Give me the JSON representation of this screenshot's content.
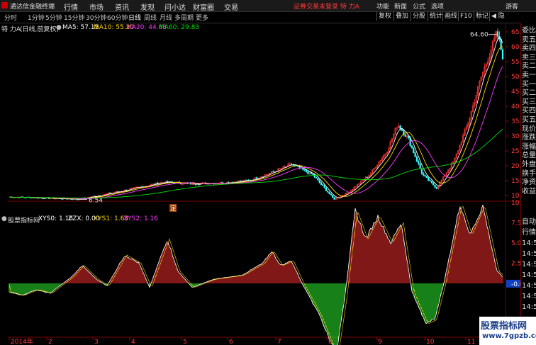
{
  "app": {
    "title": "通达信金融终端",
    "guest_label": "游客"
  },
  "menu": [
    "行情",
    "市场",
    "资讯",
    "发现",
    "问小达",
    "财富圈",
    "交易"
  ],
  "menu_right": {
    "warn": "证券交易未登录  特 力A",
    "items": [
      "功能",
      "新面",
      "公式",
      "选项"
    ]
  },
  "periods": [
    "分时",
    "1分钟",
    "5分钟",
    "15分钟",
    "30分钟",
    "60分钟",
    "日线",
    "周线",
    "月线",
    "多周期",
    "更多"
  ],
  "selected_period": "日线",
  "tools": [
    "复权",
    "叠加",
    "分股",
    "统计",
    "画线",
    "F10",
    "标记",
    "◀ 隐"
  ],
  "stock": {
    "name": "特 力A",
    "mode": "(日线,前复权)"
  },
  "ma": [
    {
      "label": "MA5: 57.15",
      "color": "#ffffff"
    },
    {
      "label": "MA10: 55.20",
      "color": "#ffd700"
    },
    {
      "label": "MA20: 44.63",
      "color": "#ff3cff"
    },
    {
      "label": "MA60: 29.83",
      "color": "#00e000"
    }
  ],
  "price_axis": [
    "65.00",
    "60.00",
    "55.00",
    "50.00",
    "45.00",
    "40.00",
    "35.00",
    "30.00",
    "25.00",
    "20.00",
    "15.00",
    "10.00"
  ],
  "price_marks": {
    "high": "64.60",
    "low": "6.54",
    "ding": "定"
  },
  "indicator": {
    "name": "股票指标网",
    "items": [
      {
        "label": "XYS0: 1.16",
        "color": "#ffffff"
      },
      {
        "label": "ZZX: 0.00",
        "color": "#ffffff"
      },
      {
        "label": "XYS1: 1.63",
        "color": "#ffd700"
      },
      {
        "label": "XYS2: 1.16",
        "color": "#ff3cff"
      }
    ]
  },
  "ind_axis": [
    "10.00",
    "7.50",
    "5.00",
    "2.50",
    "-0.08"
  ],
  "time_axis": [
    "2014年",
    "2",
    "3",
    "4",
    "5",
    "6",
    "7",
    "8",
    "9",
    "10",
    "11"
  ],
  "right_panel": [
    "委比",
    "卖五",
    "卖四",
    "卖三",
    "卖二",
    "卖一",
    "买一",
    "买二",
    "买三",
    "买四",
    "买五",
    "现价",
    "涨跌",
    "涨幅",
    "总量",
    "外盘",
    "换手",
    "净资",
    "收益"
  ],
  "right_panel_lower": [
    "自动",
    "行情",
    "14:5",
    "14:5",
    "14:5",
    "14:5",
    "14:5",
    "14:5",
    "14:5"
  ],
  "watermark": {
    "line1": "股票指标网",
    "line2": "www.7gpzb.com"
  },
  "colors": {
    "up": "#ff3333",
    "down": "#33ffff",
    "ind_pos": "#ff3030",
    "ind_neg": "#30ff30"
  }
}
